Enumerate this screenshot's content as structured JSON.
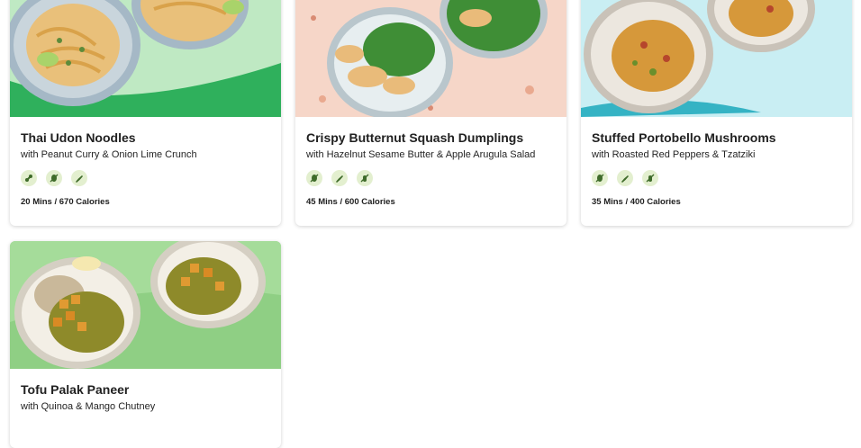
{
  "recipes": [
    {
      "title": "Thai Udon Noodles",
      "subtitle": "with Peanut Curry & Onion Lime Crunch",
      "meta": "20 Mins / 670 Calories",
      "badges": [
        "peanut-allergen-icon",
        "no-meat-icon",
        "chili-pepper-icon"
      ],
      "bg_color": "#bfe9c3"
    },
    {
      "title": "Crispy Butternut Squash Dumplings",
      "subtitle": "with Hazelnut Sesame Butter & Apple Arugula Salad",
      "meta": "45 Mins / 600 Calories",
      "badges": [
        "no-meat-icon",
        "chili-pepper-icon",
        "no-wheat-icon"
      ],
      "bg_color": "#f6d6c8"
    },
    {
      "title": "Stuffed Portobello Mushrooms",
      "subtitle": "with Roasted Red Peppers & Tzatziki",
      "meta": "35 Mins / 400 Calories",
      "badges": [
        "no-meat-icon",
        "chili-pepper-icon",
        "no-wheat-icon"
      ],
      "bg_color": "#c9eef3"
    },
    {
      "title": "Tofu Palak Paneer",
      "subtitle": "with Quinoa & Mango Chutney",
      "bg_color": "#8fcf84"
    }
  ],
  "badge_color": "#e3efcf",
  "badge_icon_color": "#3f6b2a"
}
